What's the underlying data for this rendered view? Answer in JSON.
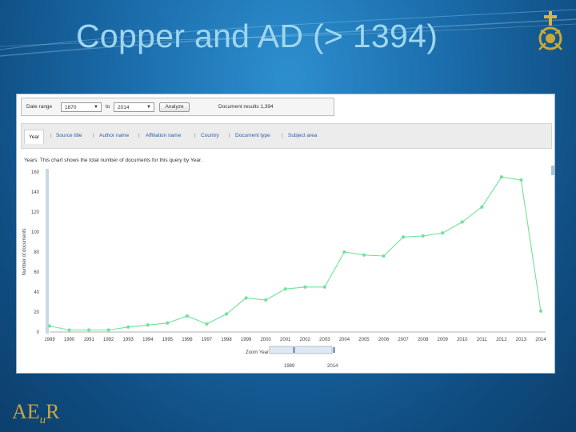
{
  "slide": {
    "title": "Copper and AD (> 1394)",
    "logo_text": "AE",
    "logo_sub": "u",
    "logo_tail": "R"
  },
  "toolbar": {
    "date_range_label": "Date range",
    "from_year": "1870",
    "to_label": "to",
    "to_year": "2014",
    "analyze_label": "Analyze",
    "document_results": "Document results 1,394"
  },
  "tabs": [
    {
      "label": "Year",
      "active": true
    },
    {
      "label": "Source title",
      "active": false
    },
    {
      "label": "Author name",
      "active": false
    },
    {
      "label": "Affiliation name",
      "active": false
    },
    {
      "label": "Country",
      "active": false
    },
    {
      "label": "Document type",
      "active": false
    },
    {
      "label": "Subject area",
      "active": false
    }
  ],
  "description": "Years: This chart shows the total number of documents for this query by Year.",
  "zoom": {
    "label": "Zoom Year",
    "from": "1989",
    "to": "2014"
  },
  "colors": {
    "line": "#6fe398",
    "bg_top": "#2d8fcf",
    "title": "#9fd6ef",
    "accent": "#c9a83a"
  },
  "chart_data": {
    "type": "line",
    "ylabel": "Number of documents",
    "xlabel": "",
    "ylim": [
      0,
      160
    ],
    "yticks": [
      0,
      20,
      40,
      60,
      80,
      100,
      120,
      140,
      160
    ],
    "grid": false,
    "x": [
      "1989",
      "1990",
      "1991",
      "1992",
      "1993",
      "1994",
      "1995",
      "1996",
      "1997",
      "1998",
      "1999",
      "2000",
      "2001",
      "2002",
      "2003",
      "2004",
      "2005",
      "2006",
      "2007",
      "2008",
      "2009",
      "2010",
      "2011",
      "2012",
      "2013",
      "2014"
    ],
    "series": [
      {
        "values": [
          6,
          2,
          2,
          2,
          5,
          7,
          9,
          16,
          8,
          18,
          34,
          32,
          43,
          45,
          45,
          80,
          77,
          76,
          95,
          96,
          99,
          110,
          125,
          155,
          152,
          21
        ]
      }
    ]
  }
}
